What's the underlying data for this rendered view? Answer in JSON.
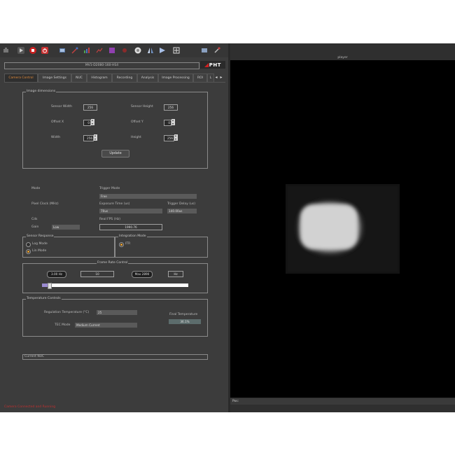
{
  "camera": {
    "name": "MV1-D2080-160-HS4",
    "logo": "PHT"
  },
  "tabs": [
    "Camera Control",
    "Image Settings",
    "NUC",
    "Histogram",
    "Recording",
    "Analysis",
    "Image Processing",
    "ROI",
    "L"
  ],
  "image_dimensions": {
    "title": "Image dimensions",
    "sensor_width_label": "Sensor Width",
    "sensor_width": "256",
    "sensor_height_label": "Sensor Height",
    "sensor_height": "256",
    "offset_x_label": "Offset X",
    "offset_x": "0",
    "offset_y_label": "Offset Y",
    "offset_y": "0",
    "width_label": "Width",
    "width": "256",
    "height_label": "Height",
    "height": "256",
    "update_label": "Update"
  },
  "settings": {
    "mode_label": "Mode",
    "trigger_mode_label": "Trigger Mode",
    "trigger_mode": "Free",
    "pixel_clock_label": "Pixel Clock (MHz)",
    "exposure_time_label": "Exposure Time (us)",
    "exposure_time": "70us",
    "trigger_delay_label": "Trigger Delay (us)",
    "trigger_delay": "140.00us",
    "cds_label": "Cds",
    "real_fps_label": "Real FPS (Hz)",
    "real_fps": "1990.76",
    "gain_label": "Gain",
    "gain": "Low"
  },
  "sensor_response": {
    "title": "Sensor Response",
    "options": [
      "Log Mode",
      "Lin Mode"
    ],
    "selected": 1
  },
  "integration_mode": {
    "title": "Integration Mode",
    "options": [
      "ITR"
    ],
    "selected": 0
  },
  "frame_rate": {
    "title": "Frame Rate Control",
    "min_label": "3.00 Hz",
    "value": "10",
    "max_label": "Max 2890",
    "unit": "Hz",
    "slider_fraction": 0.04
  },
  "temperature": {
    "title": "Temperature Controls",
    "regulation_label": "Regulation Temperature (°C)",
    "regulation_value": "25",
    "tec_mode_label": "TEC Mode",
    "tec_mode_value": "Medium Current",
    "final_temp_label": "Final Temperature",
    "final_temp_value": "36.1%"
  },
  "current_nuc": {
    "label": "Current NUC"
  },
  "status_text": "Camera Connected and Running",
  "viewer": {
    "title": "player",
    "status": "Pos:"
  },
  "colors": {
    "accent": "#e08a3a",
    "background": "#3c3c3c",
    "viewer_bg": "#000000",
    "status_red": "#c03030"
  }
}
